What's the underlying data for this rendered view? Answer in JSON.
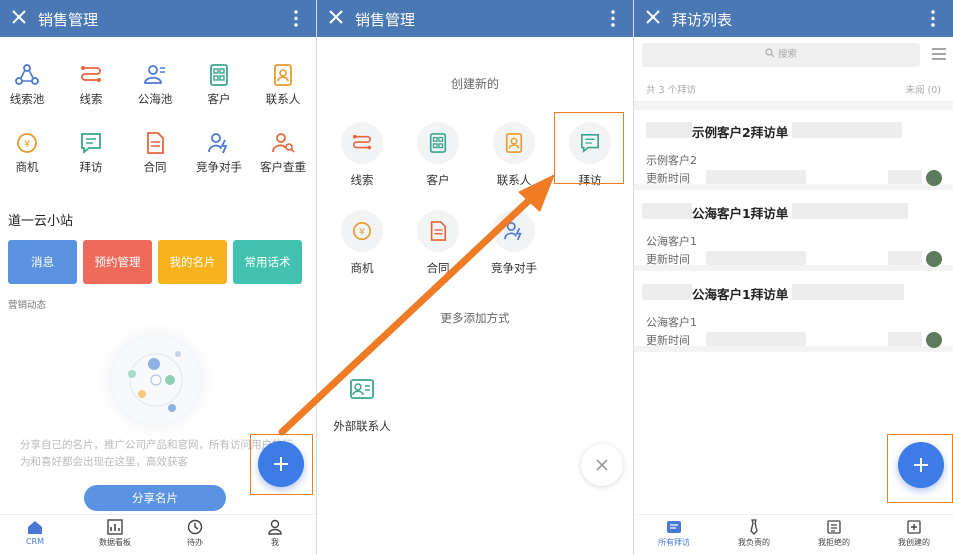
{
  "screen1": {
    "title": "销售管理",
    "apps_row1": [
      "线索池",
      "线索",
      "公海池",
      "客户",
      "联系人"
    ],
    "apps_row2": [
      "商机",
      "拜访",
      "合同",
      "竞争对手",
      "客户查重"
    ],
    "section_title": "道一云小站",
    "tiles": [
      "消息",
      "预约管理",
      "我的名片",
      "常用话术"
    ],
    "tile_colors": [
      "#5b93e2",
      "#f06a5c",
      "#f7b21c",
      "#43c2b1"
    ],
    "sub_title": "营销动态",
    "share_text": "分享自己的名片，推广公司产品和官网，所有访问用户的行为和喜好都会出现在这里，高效获客",
    "share_button": "分享名片",
    "nav": [
      "CRM",
      "数据看板",
      "待办",
      "我"
    ]
  },
  "screen2": {
    "title": "销售管理",
    "create_title": "创建新的",
    "create_row1": [
      "线索",
      "客户",
      "联系人",
      "拜访"
    ],
    "create_row2": [
      "商机",
      "合同",
      "竞争对手"
    ],
    "more_title": "更多添加方式",
    "external": "外部联系人"
  },
  "screen3": {
    "title": "拜访列表",
    "search_placeholder": "搜索",
    "count_left": "共 3 个拜访",
    "count_right": "未阅 (0)",
    "cards": [
      {
        "name": "示例客户2拜访单",
        "customer": "示例客户2",
        "updated": "更新时间"
      },
      {
        "name": "公海客户1拜访单",
        "customer": "公海客户1",
        "updated": "更新时间"
      },
      {
        "name": "公海客户1拜访单",
        "customer": "公海客户1",
        "updated": "更新时间"
      }
    ],
    "nav": [
      "所有拜访",
      "我负责的",
      "我拒绝的",
      "我创建的"
    ]
  },
  "colors": {
    "header": "#4a78b5",
    "accent_blue": "#3d7be6",
    "highlight_orange": "#f07b25"
  }
}
